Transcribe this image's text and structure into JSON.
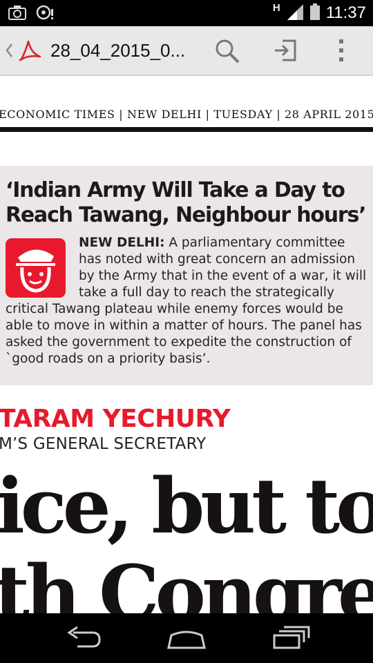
{
  "status_bar": {
    "network_type": "H",
    "time": "11:37",
    "icons": [
      "camera-icon",
      "media-icon",
      "signal-icon",
      "battery-icon"
    ]
  },
  "action_bar": {
    "file_name": "28_04_2015_0...",
    "icons": [
      "back-chevron-icon",
      "pdf-icon",
      "search-icon",
      "import-icon",
      "overflow-menu-icon"
    ]
  },
  "document": {
    "masthead": "ECONOMIC TIMES | NEW DELHI | TUESDAY | 28 APRIL 2015",
    "news_brief": {
      "headline": "‘Indian Army Will Take a Day to Reach Tawang, Neighbour hours’",
      "dateline": "NEW DELHI:",
      "body": " A parliamentary committee has noted with great concern an admission by the Army that in the event of a war, it will take a full day to reach the strategically critical Tawang plateau while enemy forces would be able to move in within a matter of hours. The panel has asked the government to expedite the construction of `good roads on a priority basis’.",
      "icon": "army-officer-icon"
    },
    "byline_name": "TARAM YECHURY",
    "byline_title": "M’S GENERAL SECRETARY",
    "big_headline_line1": "ice, but to",
    "big_headline_line2": "th Congress"
  },
  "nav_bar": {
    "icons": [
      "back-icon",
      "home-icon",
      "recents-icon"
    ]
  },
  "colors": {
    "accent_red": "#e8192c",
    "box_background": "#ebe7e8",
    "action_bar": "#e8e8e8"
  }
}
